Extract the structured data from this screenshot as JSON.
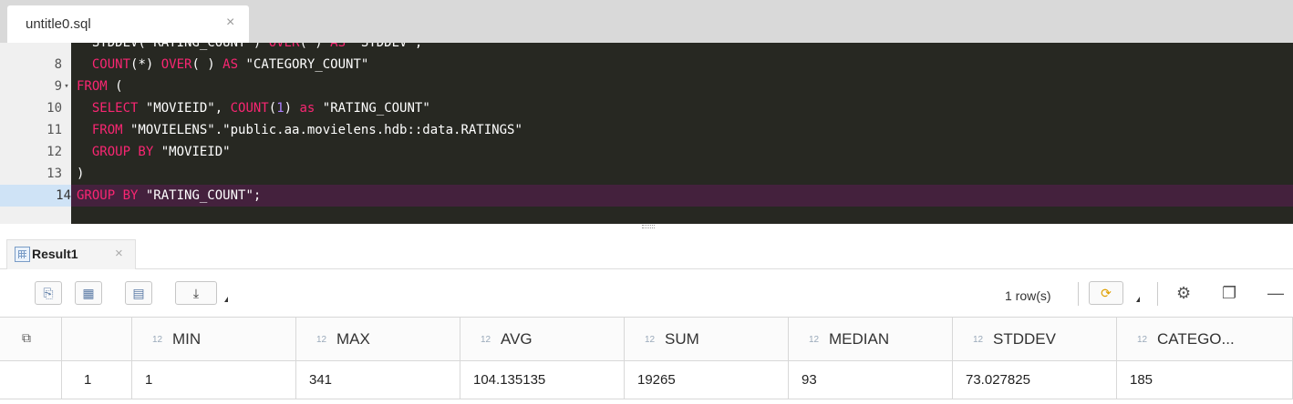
{
  "file_tab": {
    "title": "untitle0.sql",
    "close": "×"
  },
  "editor": {
    "lines": [
      {
        "n": "",
        "code": [
          {
            "t": "  STDDEV(\"RATING_COUNT\") ",
            "c": "str"
          },
          {
            "t": "OVER",
            "c": "kw"
          },
          {
            "t": "( ) ",
            "c": "str"
          },
          {
            "t": "AS",
            "c": "kw"
          },
          {
            "t": " \"STDDEV\",",
            "c": "str"
          }
        ]
      },
      {
        "n": "8",
        "code": [
          {
            "t": "  ",
            "c": "str"
          },
          {
            "t": "COUNT",
            "c": "kw"
          },
          {
            "t": "(*) ",
            "c": "str"
          },
          {
            "t": "OVER",
            "c": "kw"
          },
          {
            "t": "( ) ",
            "c": "str"
          },
          {
            "t": "AS",
            "c": "kw"
          },
          {
            "t": " \"CATEGORY_COUNT\"",
            "c": "str"
          }
        ]
      },
      {
        "n": "9",
        "fold": "▾",
        "code": [
          {
            "t": "FROM",
            "c": "kw"
          },
          {
            "t": " (",
            "c": "str"
          }
        ]
      },
      {
        "n": "10",
        "code": [
          {
            "t": "  ",
            "c": "str"
          },
          {
            "t": "SELECT",
            "c": "kw"
          },
          {
            "t": " \"MOVIEID\", ",
            "c": "str"
          },
          {
            "t": "COUNT",
            "c": "kw"
          },
          {
            "t": "(",
            "c": "str"
          },
          {
            "t": "1",
            "c": "num"
          },
          {
            "t": ") ",
            "c": "str"
          },
          {
            "t": "as",
            "c": "kw"
          },
          {
            "t": " \"RATING_COUNT\"",
            "c": "str"
          }
        ]
      },
      {
        "n": "11",
        "code": [
          {
            "t": "  ",
            "c": "str"
          },
          {
            "t": "FROM",
            "c": "kw"
          },
          {
            "t": " \"MOVIELENS\".\"public.aa.movielens.hdb::data.RATINGS\"",
            "c": "str"
          }
        ]
      },
      {
        "n": "12",
        "code": [
          {
            "t": "  ",
            "c": "str"
          },
          {
            "t": "GROUP BY",
            "c": "kw"
          },
          {
            "t": " \"MOVIEID\"",
            "c": "str"
          }
        ]
      },
      {
        "n": "13",
        "code": [
          {
            "t": ")",
            "c": "str"
          }
        ]
      },
      {
        "n": "14",
        "active": true,
        "code": [
          {
            "t": "GROUP BY",
            "c": "kw"
          },
          {
            "t": " \"RATING_COUNT\";",
            "c": "str"
          }
        ]
      }
    ]
  },
  "result_tab": {
    "label": "Result1",
    "close": "×"
  },
  "toolbar": {
    "rows_label": "1 row(s)"
  },
  "grid": {
    "type_tag": "12",
    "columns": [
      "MIN",
      "MAX",
      "AVG",
      "SUM",
      "MEDIAN",
      "STDDEV",
      "CATEGO..."
    ],
    "rows": [
      {
        "index": "1",
        "values": [
          "1",
          "341",
          "104.135135",
          "19265",
          "93",
          "73.027825",
          "185"
        ]
      }
    ]
  },
  "colors": {
    "editor_bg": "#272822",
    "keyword": "#f92672",
    "number": "#ae81ff",
    "active_line": "#44213d"
  }
}
